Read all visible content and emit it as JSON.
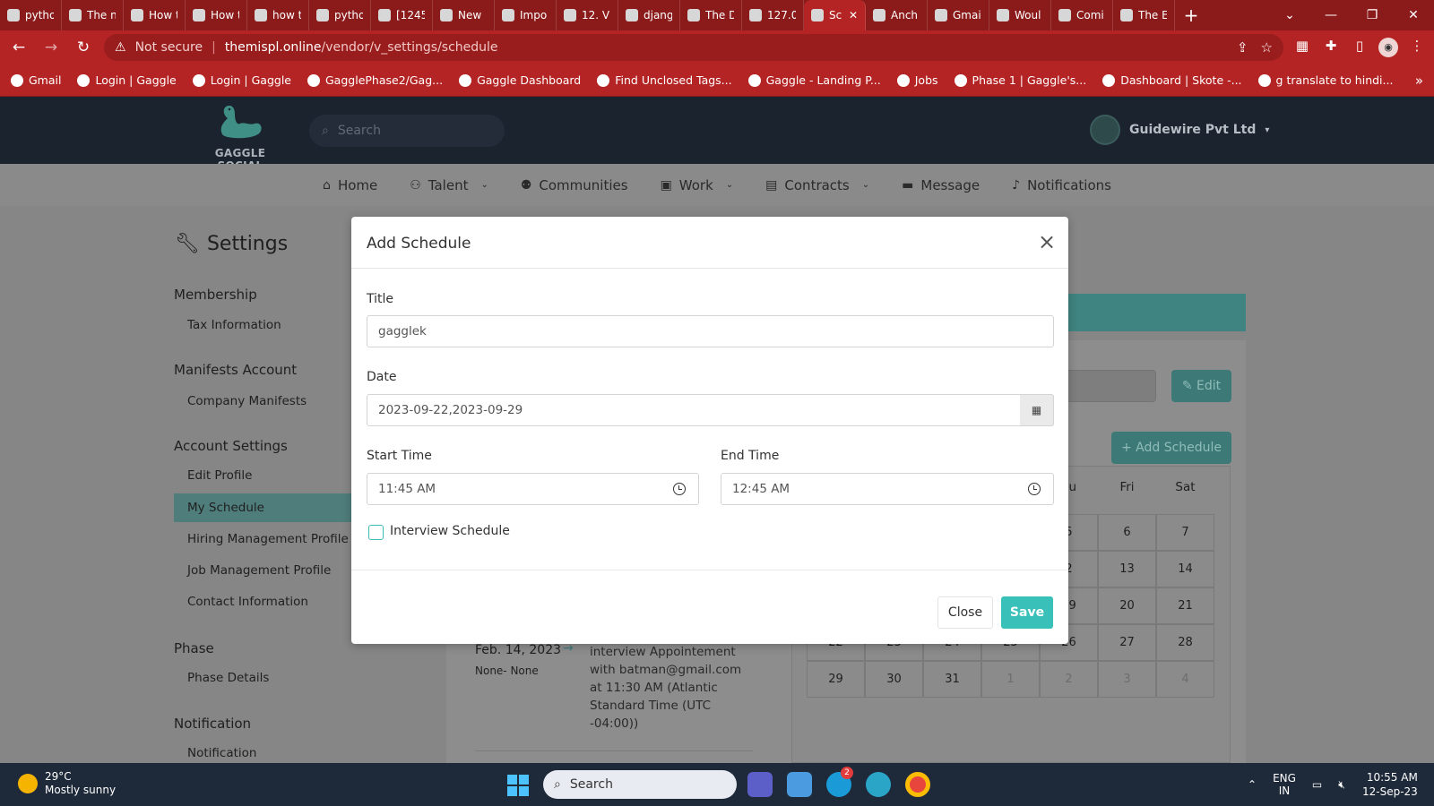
{
  "browser": {
    "tabs": [
      {
        "label": "pytho",
        "icon": "python-icon"
      },
      {
        "label": "The n",
        "icon": "django-icon"
      },
      {
        "label": "How t",
        "icon": "stack-icon"
      },
      {
        "label": "How t",
        "icon": "terminal-icon"
      },
      {
        "label": "how t",
        "icon": "google-icon"
      },
      {
        "label": "pytho",
        "icon": "stack-icon"
      },
      {
        "label": "[1245",
        "icon": "globe-icon"
      },
      {
        "label": "New",
        "icon": "openai-icon"
      },
      {
        "label": "Impo",
        "icon": "medium-icon"
      },
      {
        "label": "12. Vi",
        "icon": "python-icon"
      },
      {
        "label": "djang",
        "icon": "notion-icon"
      },
      {
        "label": "The D",
        "icon": "django-icon"
      },
      {
        "label": "127.0",
        "icon": "globe-icon"
      },
      {
        "label": "Sc",
        "icon": "gaggle-icon",
        "active": true
      },
      {
        "label": "Anch",
        "icon": "gaggle-icon"
      },
      {
        "label": "Gmai",
        "icon": "google-icon"
      },
      {
        "label": "Woul",
        "icon": "google-icon"
      },
      {
        "label": "Comi",
        "icon": "gaggle-icon"
      },
      {
        "label": "The E",
        "icon": "gaggle-icon"
      }
    ],
    "new_tab": "+",
    "not_secure": "Not secure",
    "url_host": "themispl.online",
    "url_path": "/vendor/v_settings/schedule",
    "bookmarks": [
      "Gmail",
      "Login | Gaggle",
      "Login | Gaggle",
      "GagglePhase2/Gag...",
      "Gaggle Dashboard",
      "Find Unclosed Tags...",
      "Gaggle - Landing P...",
      "Jobs",
      "Phase 1 | Gaggle's...",
      "Dashboard | Skote -...",
      "g translate to hindi..."
    ],
    "bookmarks_more": "»"
  },
  "header": {
    "logo_text": "GAGGLE SOCIAL",
    "search_placeholder": "Search",
    "account_name": "Guidewire Pvt Ltd"
  },
  "nav": [
    {
      "label": "Home",
      "icon": "home-icon",
      "dropdown": false
    },
    {
      "label": "Talent",
      "icon": "user-plus-icon",
      "dropdown": true
    },
    {
      "label": "Communities",
      "icon": "users-icon",
      "dropdown": false
    },
    {
      "label": "Work",
      "icon": "briefcase-icon",
      "dropdown": true
    },
    {
      "label": "Contracts",
      "icon": "file-icon",
      "dropdown": true
    },
    {
      "label": "Message",
      "icon": "message-icon",
      "dropdown": false
    },
    {
      "label": "Notifications",
      "icon": "bell-icon",
      "dropdown": false
    }
  ],
  "sidebar": {
    "title": "Settings",
    "sections": [
      {
        "title": "Membership",
        "items": [
          "Tax Information"
        ]
      },
      {
        "title": "Manifests Account",
        "items": [
          "Company Manifests"
        ]
      },
      {
        "title": "Account Settings",
        "items": [
          "Edit Profile",
          "My Schedule",
          "Hiring Management Profile",
          "Job Management Profile",
          "Contact Information"
        ]
      },
      {
        "title": "Phase",
        "items": [
          "Phase Details"
        ]
      },
      {
        "title": "Notification",
        "items": [
          "Notification"
        ]
      }
    ],
    "active_item": "My Schedule"
  },
  "schedule": {
    "edit_label": "Edit",
    "add_label": "+ Add Schedule",
    "event": {
      "date": "Feb. 14, 2023",
      "time": "None- None",
      "description": "interview Appointement with batman@gmail.com at 11:30 AM (Atlantic Standard Time (UTC -04:00))"
    }
  },
  "calendar": {
    "weekdays_visible": [
      "hu",
      "Fri",
      "Sat"
    ],
    "weeks": [
      [
        "",
        "",
        "",
        "",
        "5",
        "6",
        "7"
      ],
      [
        "",
        "",
        "",
        "",
        "2",
        "13",
        "14"
      ],
      [
        "15",
        "16",
        "17",
        "18",
        "19",
        "20",
        "21"
      ],
      [
        "22",
        "23",
        "24",
        "25",
        "26",
        "27",
        "28"
      ],
      [
        "29",
        "30",
        "31",
        "1",
        "2",
        "3",
        "4"
      ]
    ]
  },
  "modal": {
    "title": "Add Schedule",
    "title_label": "Title",
    "title_value": "gagglek",
    "date_label": "Date",
    "date_value": "2023-09-22,2023-09-29",
    "start_label": "Start Time",
    "start_value": "11:45  AM",
    "end_label": "End Time",
    "end_value": "12:45  AM",
    "checkbox_label": "Interview Schedule",
    "checkbox_checked": false,
    "close_label": "Close",
    "save_label": "Save"
  },
  "taskbar": {
    "temperature": "29°C",
    "weather": "Mostly sunny",
    "search": "Search",
    "lang_top": "ENG",
    "lang_bottom": "IN",
    "time": "10:55 AM",
    "date": "12-Sep-23",
    "skype_badge": "2"
  },
  "colors": {
    "browser_frame": "#b52424",
    "app_header": "#1b232e",
    "accent_teal": "#39c0b8",
    "overlay_dim": "#868686"
  }
}
